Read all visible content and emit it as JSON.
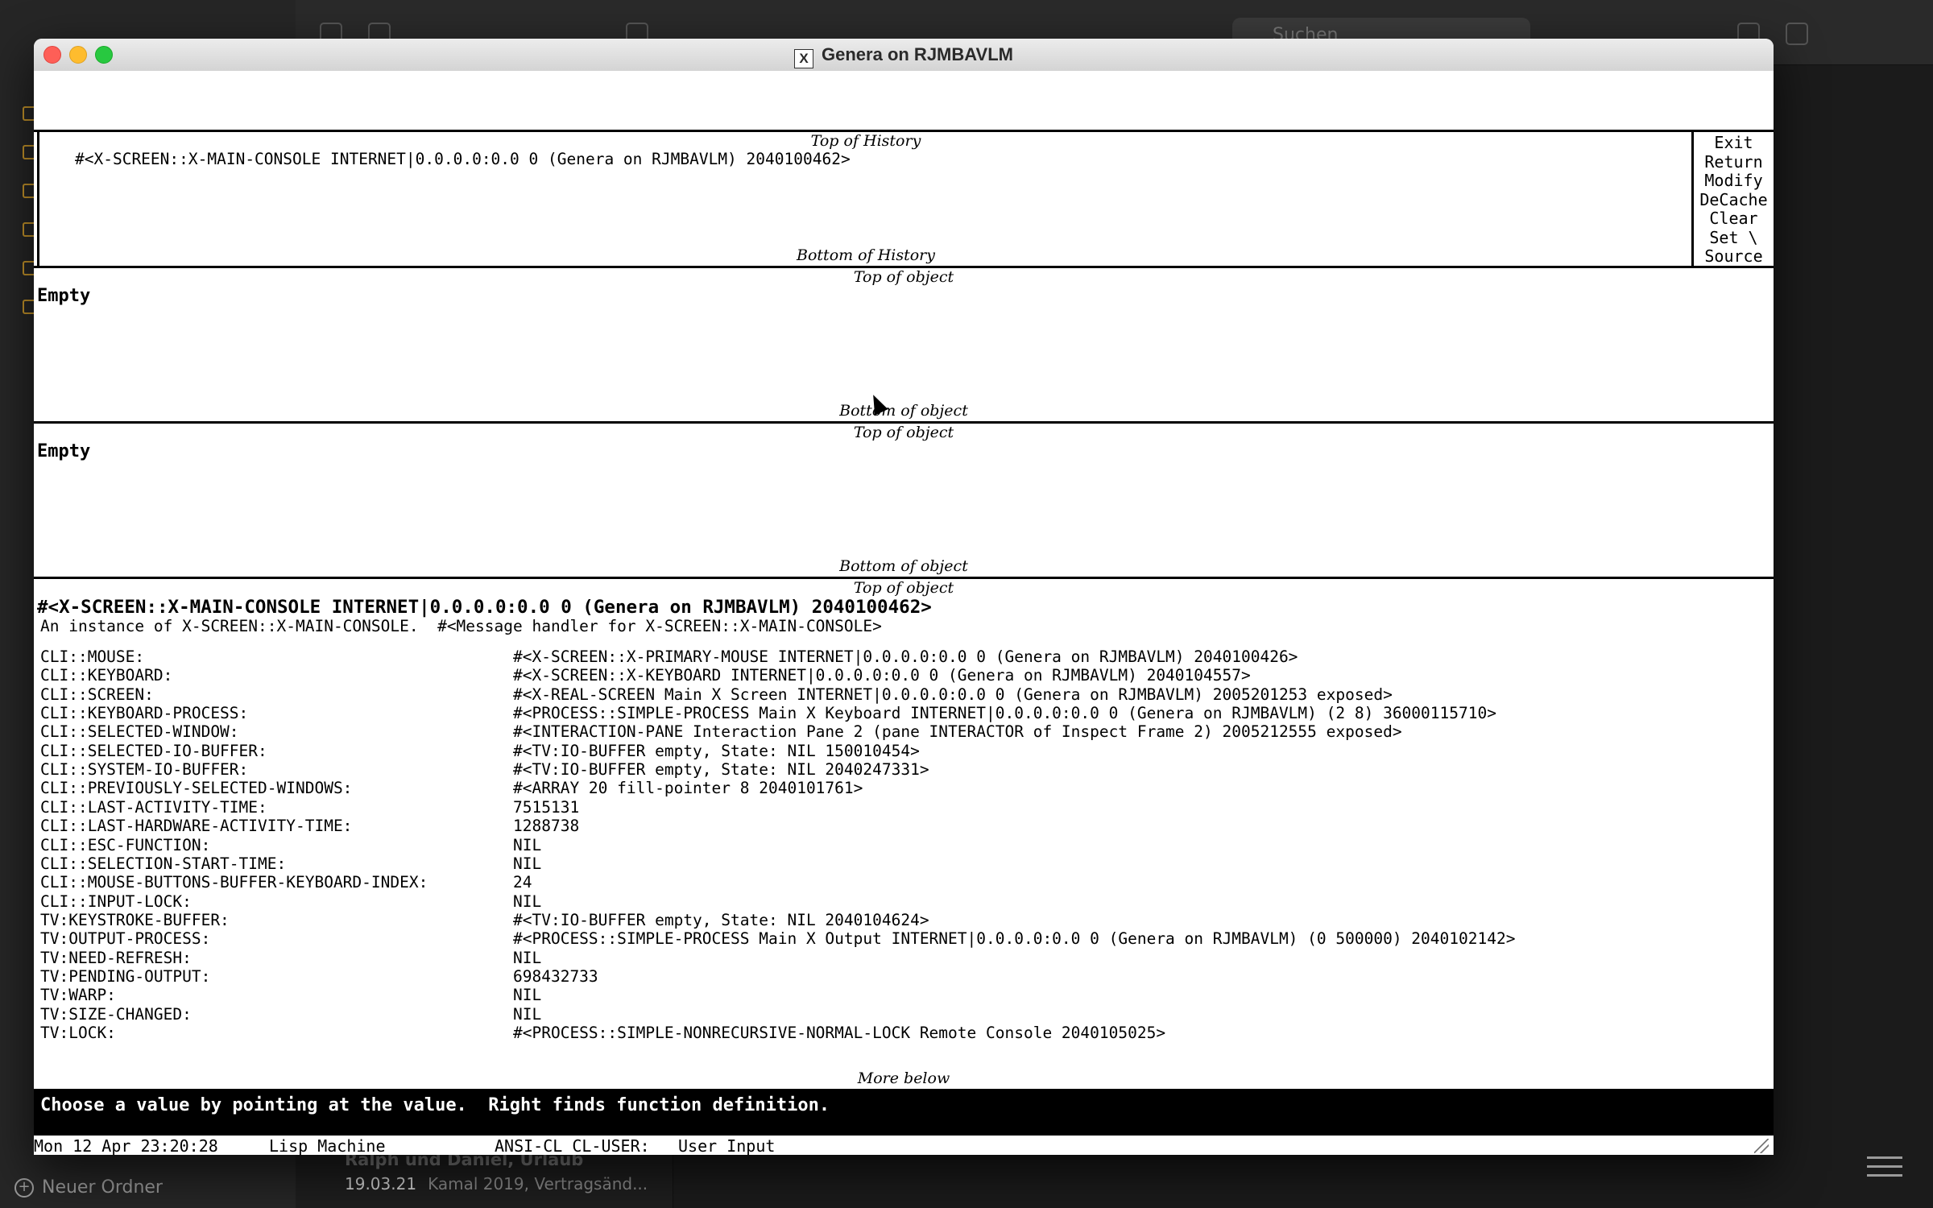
{
  "background_app": {
    "sidebar_new_folder": "Neuer Ordner",
    "note_title": "Ralph und Daniel, Urlaub",
    "note_date": "19.03.21",
    "note_preview": "Kamal 2019, Vertragsänd...",
    "search_placeholder": "Suchen"
  },
  "window": {
    "title": "Genera on RJMBAVLM"
  },
  "history": {
    "top_label": "Top of History",
    "bottom_label": "Bottom of History",
    "entry": "#<X-SCREEN::X-MAIN-CONSOLE INTERNET|0.0.0.0:0.0 0 (Genera on RJMBAVLM) 2040100462>"
  },
  "commands": [
    "Exit",
    "Return",
    "Modify",
    "DeCache",
    "Clear",
    "Set \\",
    "Source"
  ],
  "object_pane_1": {
    "top_label": "Top of object",
    "content": "Empty",
    "bottom_label": "Bottom of object"
  },
  "object_pane_2": {
    "top_label": "Top of object",
    "content": "Empty",
    "bottom_label": "Bottom of object"
  },
  "object_pane_3": {
    "top_label": "Top of object",
    "heading": "#<X-SCREEN::X-MAIN-CONSOLE INTERNET|0.0.0.0:0.0 0 (Genera on RJMBAVLM) 2040100462>",
    "subheading": "An instance of X-SCREEN::X-MAIN-CONSOLE.  #<Message handler for X-SCREEN::X-MAIN-CONSOLE>",
    "slots": [
      {
        "k": "CLI::MOUSE:",
        "v": "#<X-SCREEN::X-PRIMARY-MOUSE INTERNET|0.0.0.0:0.0 0 (Genera on RJMBAVLM) 2040100426>"
      },
      {
        "k": "CLI::KEYBOARD:",
        "v": "#<X-SCREEN::X-KEYBOARD INTERNET|0.0.0.0:0.0 0 (Genera on RJMBAVLM) 2040104557>"
      },
      {
        "k": "CLI::SCREEN:",
        "v": "#<X-REAL-SCREEN Main X Screen INTERNET|0.0.0.0:0.0 0 (Genera on RJMBAVLM) 2005201253 exposed>"
      },
      {
        "k": "CLI::KEYBOARD-PROCESS:",
        "v": "#<PROCESS::SIMPLE-PROCESS Main X Keyboard INTERNET|0.0.0.0:0.0 0 (Genera on RJMBAVLM) (2 8) 36000115710>"
      },
      {
        "k": "CLI::SELECTED-WINDOW:",
        "v": "#<INTERACTION-PANE Interaction Pane 2 (pane INTERACTOR of Inspect Frame 2) 2005212555 exposed>"
      },
      {
        "k": "CLI::SELECTED-IO-BUFFER:",
        "v": "#<TV:IO-BUFFER empty, State: NIL 150010454>"
      },
      {
        "k": "CLI::SYSTEM-IO-BUFFER:",
        "v": "#<TV:IO-BUFFER empty, State: NIL 2040247331>"
      },
      {
        "k": "CLI::PREVIOUSLY-SELECTED-WINDOWS:",
        "v": "#<ARRAY 20 fill-pointer 8 2040101761>"
      },
      {
        "k": "CLI::LAST-ACTIVITY-TIME:",
        "v": "7515131"
      },
      {
        "k": "CLI::LAST-HARDWARE-ACTIVITY-TIME:",
        "v": "1288738"
      },
      {
        "k": "CLI::ESC-FUNCTION:",
        "v": "NIL"
      },
      {
        "k": "CLI::SELECTION-START-TIME:",
        "v": "NIL"
      },
      {
        "k": "CLI::MOUSE-BUTTONS-BUFFER-KEYBOARD-INDEX:",
        "v": "24"
      },
      {
        "k": "CLI::INPUT-LOCK:",
        "v": "NIL"
      },
      {
        "k": "TV:KEYSTROKE-BUFFER:",
        "v": "#<TV:IO-BUFFER empty, State: NIL 2040104624>"
      },
      {
        "k": "TV:OUTPUT-PROCESS:",
        "v": "#<PROCESS::SIMPLE-PROCESS Main X Output INTERNET|0.0.0.0:0.0 0 (Genera on RJMBAVLM) (0 500000) 2040102142>"
      },
      {
        "k": "TV:NEED-REFRESH:",
        "v": "NIL"
      },
      {
        "k": "TV:PENDING-OUTPUT:",
        "v": "698432733"
      },
      {
        "k": "TV:WARP:",
        "v": "NIL"
      },
      {
        "k": "TV:SIZE-CHANGED:",
        "v": "NIL"
      },
      {
        "k": "TV:LOCK:",
        "v": "#<PROCESS::SIMPLE-NONRECURSIVE-NORMAL-LOCK Remote Console 2040105025>"
      }
    ],
    "more_label": "More below"
  },
  "prompt": "Choose a value by pointing at the value.  Right finds function definition.",
  "status": {
    "datetime": "Mon 12 Apr 23:20:28",
    "user": "Lisp Machine",
    "package": "ANSI-CL CL-USER:",
    "state": "User Input"
  }
}
